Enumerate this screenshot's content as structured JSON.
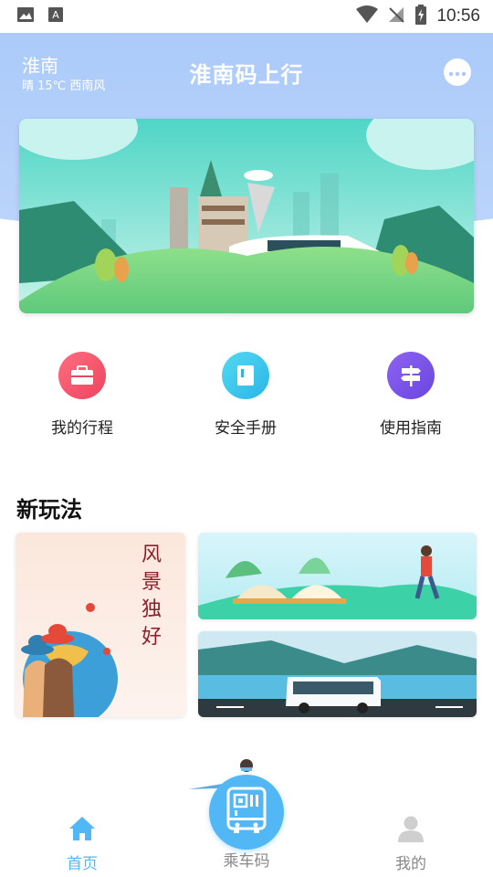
{
  "status_bar": {
    "time": "10:56"
  },
  "header": {
    "city": "淮南",
    "weather": "晴 15℃ 西南风",
    "title": "淮南码上行"
  },
  "features": [
    {
      "label": "我的行程",
      "icon": "briefcase-icon",
      "color": "#f2566b"
    },
    {
      "label": "安全手册",
      "icon": "handbook-icon",
      "color": "#3ec6ec"
    },
    {
      "label": "使用指南",
      "icon": "signpost-icon",
      "color": "#7b55e8"
    }
  ],
  "section": {
    "title": "新玩法",
    "card_text": "风景独好"
  },
  "bottom_nav": {
    "items": [
      {
        "label": "首页",
        "icon": "home-icon",
        "active": true
      },
      {
        "label": "乘车码",
        "icon": "bus-qr-icon",
        "active": false
      },
      {
        "label": "我的",
        "icon": "profile-icon",
        "active": false
      }
    ]
  },
  "colors": {
    "header_bg": "#a9c9f9",
    "accent": "#52b7f5",
    "nav_inactive": "#888888"
  }
}
